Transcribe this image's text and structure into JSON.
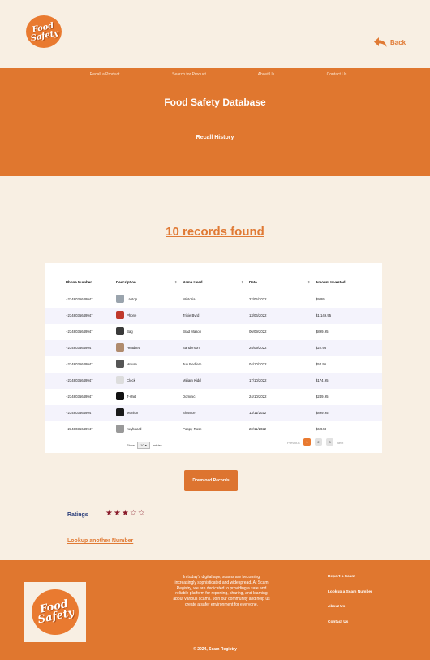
{
  "brand": {
    "logo_text": "Food Safety"
  },
  "header": {
    "back_label": "Back"
  },
  "nav": {
    "items": [
      "Recall a Product",
      "Search for Product",
      "About Us",
      "Contact Us"
    ]
  },
  "hero": {
    "title": "Food Safety Database",
    "subtitle": "Recall History"
  },
  "results": {
    "heading": "10 records found"
  },
  "table": {
    "columns": [
      "Phone Number",
      "Description",
      "Name Used",
      "Date",
      "Amount Invested"
    ],
    "rows": [
      {
        "phone": "+2348035649947",
        "description": "Laptop",
        "name": "Wiktoria",
        "date": "22/05/2022",
        "amount": "$9.95",
        "thumb": "laptop-icon"
      },
      {
        "phone": "+2348035649947",
        "description": "Phone",
        "name": "Trixie Byrd",
        "date": "13/06/2022",
        "amount": "$1,149.95",
        "thumb": "phone-icon"
      },
      {
        "phone": "+2348035649947",
        "description": "Bag",
        "name": "Brad Mason",
        "date": "06/09/2022",
        "amount": "$899.95",
        "thumb": "bag-icon"
      },
      {
        "phone": "+2348035649947",
        "description": "Headset",
        "name": "Sanderson",
        "date": "25/09/2022",
        "amount": "$22.95",
        "thumb": "headset-icon"
      },
      {
        "phone": "+2348035649947",
        "description": "Mouse",
        "name": "Jun Redfern",
        "date": "04/10/2022",
        "amount": "$54.95",
        "thumb": "mouse-icon"
      },
      {
        "phone": "+2348035649947",
        "description": "Clock",
        "name": "Miriam Kidd",
        "date": "17/10/2022",
        "amount": "$174.95",
        "thumb": "clock-icon"
      },
      {
        "phone": "+2348035649947",
        "description": "T-shirt",
        "name": "Dominic",
        "date": "24/10/2022",
        "amount": "$249.95",
        "thumb": "tshirt-icon"
      },
      {
        "phone": "+2348035649947",
        "description": "Monitor",
        "name": "Shanice",
        "date": "13/11/2022",
        "amount": "$899.95",
        "thumb": "monitor-icon"
      },
      {
        "phone": "+2348035649947",
        "description": "Keyboard",
        "name": "Poppy-Rose",
        "date": "22/11/2022",
        "amount": "$6,948",
        "thumb": "keyboard-icon"
      }
    ],
    "footer": {
      "show_label": "Show",
      "page_size": "10",
      "entries_label": "entries",
      "previous": "Previous",
      "pages": [
        "1",
        "2",
        "3"
      ],
      "next": "Next"
    }
  },
  "download": {
    "label": "Download Records"
  },
  "ratings": {
    "label": "Ratings",
    "stars": "★★★☆☆",
    "value": 3,
    "max": 5
  },
  "lookup": {
    "label": "Lookup another Number"
  },
  "footer": {
    "text": "In today's digital age, scams are becoming increasingly sophisticated and widespread. At Scam Registry, we are dedicated to providing a safe and reliable platform for reporting, sharing, and learning about various scams. Join our community and help us create a safer environment for everyone.",
    "links": [
      "Report a Scam",
      "Lookup a Scam Number",
      "About Us",
      "Contact Us"
    ],
    "copyright": "2024, Scam Registry"
  },
  "colors": {
    "primary": "#e0772f",
    "background": "#f8efe3",
    "star": "#8a1c2c",
    "ratings_label": "#2a3d7a"
  }
}
